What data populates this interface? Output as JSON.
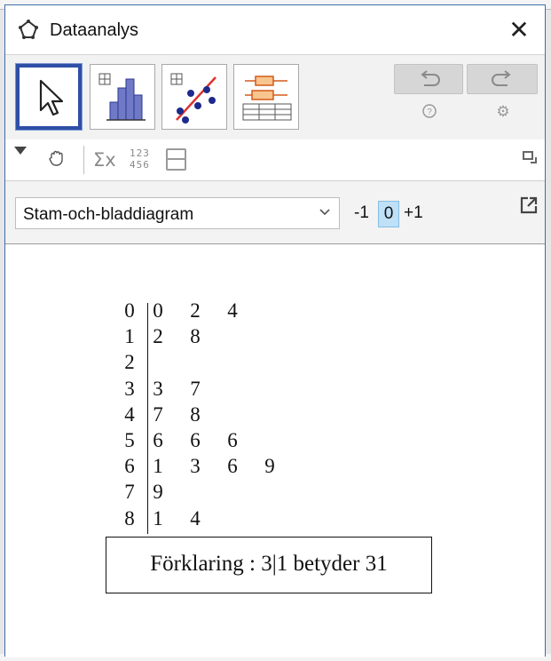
{
  "window": {
    "title": "Dataanalys",
    "close_glyph": "✕"
  },
  "toolbar": {
    "tools": [
      {
        "name": "move-tool",
        "icon": "arrow-cursor-icon",
        "selected": true
      },
      {
        "name": "one-variable-analysis",
        "icon": "histogram-icon",
        "selected": false
      },
      {
        "name": "two-variable-regression",
        "icon": "scatter-regression-icon",
        "selected": false
      },
      {
        "name": "multi-variable-analysis",
        "icon": "boxplot-table-icon",
        "selected": false
      }
    ],
    "undo_icon": "undo-icon",
    "redo_icon": "redo-icon",
    "help_glyph": "?",
    "settings_glyph": "⚙"
  },
  "subtoolbar": {
    "sigma_label": "Σx",
    "numbers_top": "123",
    "numbers_bottom": "456"
  },
  "controls": {
    "plot_type": "Stam-och-bladdiagram",
    "adjust_minus": "-1",
    "adjust_value": "0",
    "adjust_plus": "+1"
  },
  "chart_data": {
    "type": "table",
    "stems": [
      "0",
      "1",
      "2",
      "3",
      "4",
      "5",
      "6",
      "7",
      "8"
    ],
    "leaves": [
      [
        "0",
        "2",
        "4"
      ],
      [
        "2",
        "8"
      ],
      [],
      [
        "3",
        "7"
      ],
      [
        "7",
        "8"
      ],
      [
        "6",
        "6",
        "6"
      ],
      [
        "1",
        "3",
        "6",
        "9"
      ],
      [
        "9"
      ],
      [
        "1",
        "4"
      ]
    ],
    "legend": "Förklaring :  3|1 betyder 31"
  },
  "colors": {
    "selection_border": "#2e4fa6",
    "zero_highlight": "#bfe0f6"
  }
}
